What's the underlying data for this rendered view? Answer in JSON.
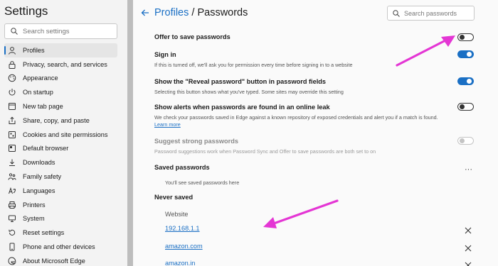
{
  "sidebar": {
    "title": "Settings",
    "search_placeholder": "Search settings",
    "items": [
      {
        "label": "Profiles",
        "icon": "profile-icon",
        "active": true
      },
      {
        "label": "Privacy, search, and services",
        "icon": "lock-icon"
      },
      {
        "label": "Appearance",
        "icon": "appearance-icon"
      },
      {
        "label": "On startup",
        "icon": "power-icon"
      },
      {
        "label": "New tab page",
        "icon": "new-tab-icon"
      },
      {
        "label": "Share, copy, and paste",
        "icon": "share-icon"
      },
      {
        "label": "Cookies and site permissions",
        "icon": "cookies-icon"
      },
      {
        "label": "Default browser",
        "icon": "browser-icon"
      },
      {
        "label": "Downloads",
        "icon": "download-icon"
      },
      {
        "label": "Family safety",
        "icon": "family-icon"
      },
      {
        "label": "Languages",
        "icon": "languages-icon"
      },
      {
        "label": "Printers",
        "icon": "printer-icon"
      },
      {
        "label": "System",
        "icon": "system-icon"
      },
      {
        "label": "Reset settings",
        "icon": "reset-icon"
      },
      {
        "label": "Phone and other devices",
        "icon": "phone-icon"
      },
      {
        "label": "About Microsoft Edge",
        "icon": "edge-icon"
      }
    ]
  },
  "header": {
    "breadcrumb_link": "Profiles",
    "breadcrumb_sep": " / ",
    "title": "Passwords",
    "search_placeholder": "Search passwords"
  },
  "settings": {
    "offer": {
      "title": "Offer to save passwords",
      "state": "off"
    },
    "signin": {
      "title": "Sign in",
      "desc": "If this is turned off, we'll ask you for permission every time before signing in to a website",
      "state": "on"
    },
    "reveal": {
      "title": "Show the \"Reveal password\" button in password fields",
      "desc": "Selecting this button shows what you've typed. Some sites may override this setting",
      "state": "on"
    },
    "leak": {
      "title": "Show alerts when passwords are found in an online leak",
      "desc": "We check your passwords saved in Edge against a known repository of exposed credentials and alert you if a match is found.",
      "link": "Learn more",
      "state": "off"
    },
    "strong": {
      "title": "Suggest strong passwords",
      "desc": "Password suggestions work when Password Sync and Offer to save passwords are both set to on",
      "state": "disabled"
    }
  },
  "saved": {
    "title": "Saved passwords",
    "more_label": "···",
    "empty_text": "You'll see saved passwords here"
  },
  "never_saved": {
    "title": "Never saved",
    "column_header": "Website",
    "sites": [
      "192.168.1.1",
      "amazon.com",
      "amazon.in"
    ]
  },
  "colors": {
    "accent": "#1a6fc4",
    "annotation_arrow": "#e436d4"
  }
}
